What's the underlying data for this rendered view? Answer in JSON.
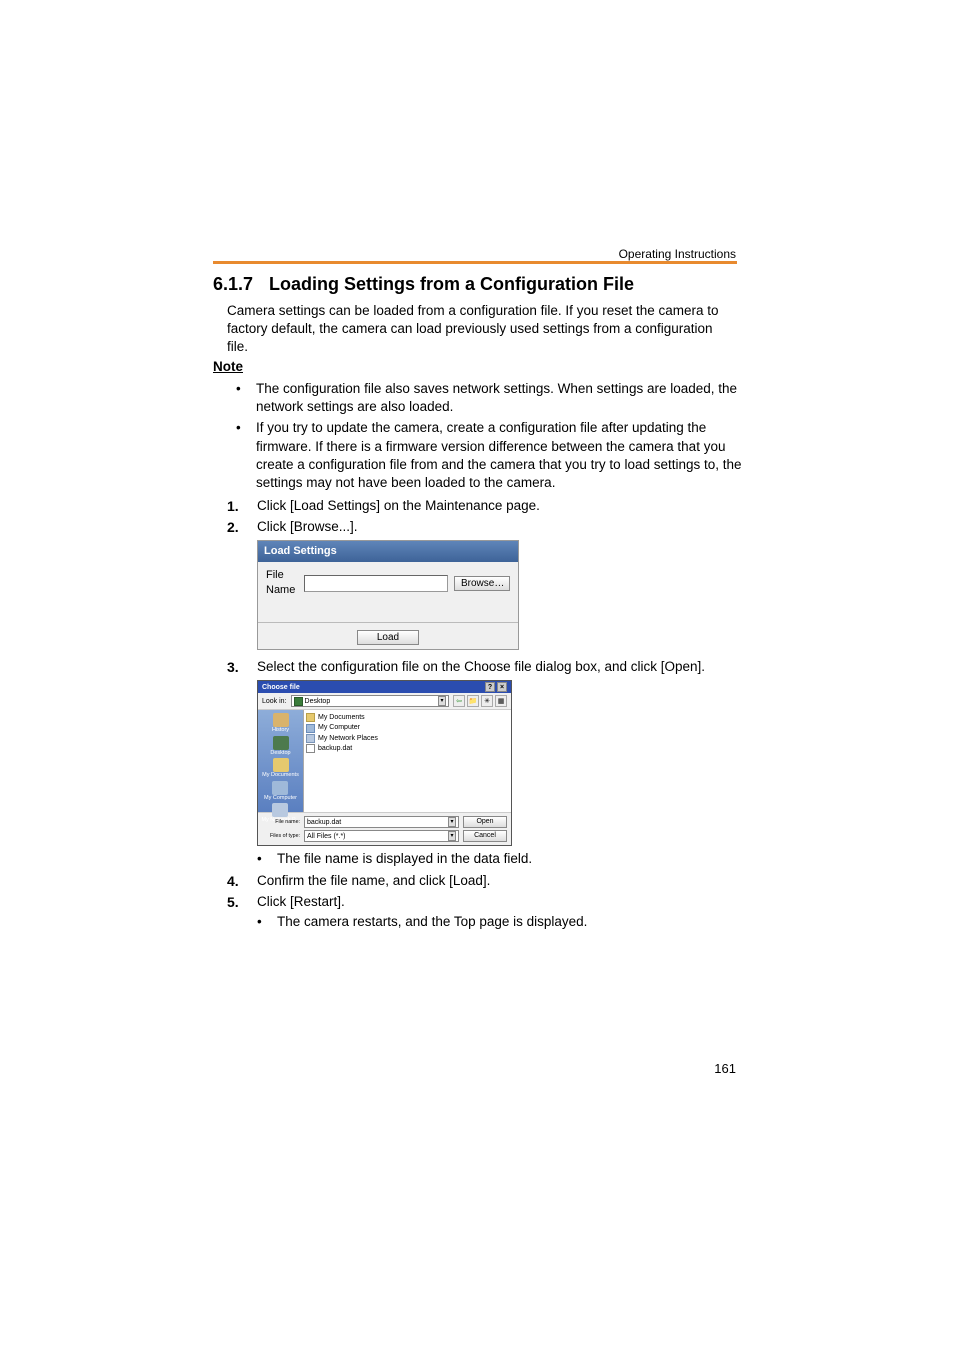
{
  "header_title": "Operating Instructions",
  "section_number": "6.1.7",
  "section_title": "Loading Settings from a Configuration File",
  "intro": "Camera settings can be loaded from a configuration file. If you reset the camera to factory default, the camera can load previously used settings from a configuration file.",
  "note_heading": "Note",
  "note_items": [
    "The configuration file also saves network settings. When settings are loaded, the network settings are also loaded.",
    "If you try to update the camera, create a configuration file after updating the firmware. If there is a firmware version difference between the camera that you create a configuration file from and the camera that you try to load settings to, the settings may not have been loaded to the camera."
  ],
  "steps": {
    "s1": {
      "num": "1.",
      "text": "Click [Load Settings] on the Maintenance page."
    },
    "s2": {
      "num": "2.",
      "text": "Click [Browse...]."
    },
    "s3": {
      "num": "3.",
      "text": "Select the configuration file on the Choose file dialog box, and click [Open]."
    },
    "s3_sub": "The file name is displayed in the data field.",
    "s4": {
      "num": "4.",
      "text": "Confirm the file name, and click [Load]."
    },
    "s5": {
      "num": "5.",
      "text": "Click [Restart]."
    },
    "s5_sub": "The camera restarts, and the Top page is displayed."
  },
  "load_settings_ui": {
    "title": "Load Settings",
    "file_name_label": "File Name",
    "browse_btn": "Browse…",
    "load_btn": "Load"
  },
  "choose_file_ui": {
    "title": "Choose file",
    "look_in_label": "Look in:",
    "look_in_value": "Desktop",
    "sidebar": {
      "history": "History",
      "desktop": "Desktop",
      "my_documents": "My Documents",
      "my_computer": "My Computer",
      "my_network": "My Network P..."
    },
    "files": {
      "my_documents": "My Documents",
      "my_computer": "My Computer",
      "my_network_places": "My Network Places",
      "backup": "backup.dat"
    },
    "file_name_label": "File name:",
    "file_name_value": "backup.dat",
    "files_of_type_label": "Files of type:",
    "files_of_type_value": "All Files (*.*)",
    "open_btn": "Open",
    "cancel_btn": "Cancel"
  },
  "page_number": "161"
}
